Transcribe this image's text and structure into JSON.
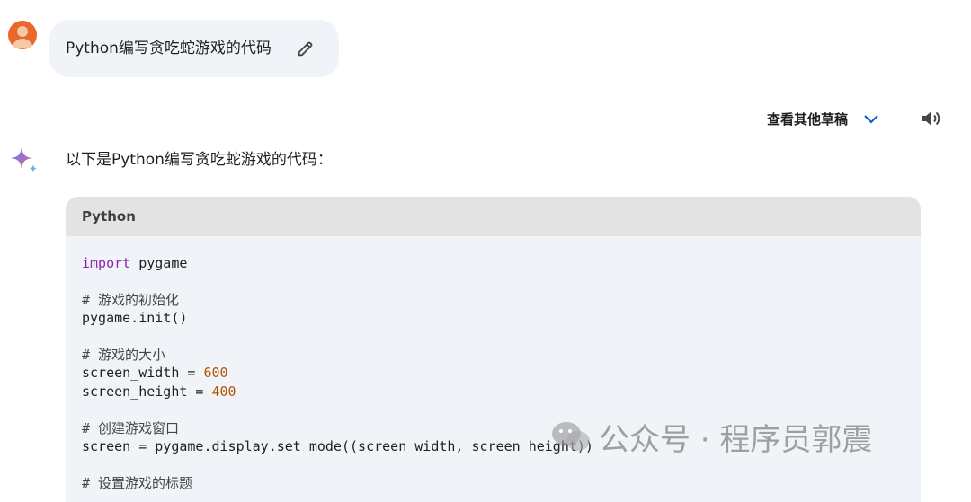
{
  "conversation": {
    "user_prompt": "Python编写贪吃蛇游戏的代码",
    "view_drafts_label": "查看其他草稿",
    "reply_intro": "以下是Python编写贪吃蛇游戏的代码："
  },
  "code_block": {
    "language": "Python",
    "lines": [
      {
        "parts": [
          {
            "t": "import",
            "c": "kw"
          },
          {
            "t": " pygame"
          }
        ]
      },
      {
        "parts": []
      },
      {
        "parts": [
          {
            "t": "# 游戏的初始化",
            "c": "comment"
          }
        ]
      },
      {
        "parts": [
          {
            "t": "pygame.init()"
          }
        ]
      },
      {
        "parts": []
      },
      {
        "parts": [
          {
            "t": "# 游戏的大小",
            "c": "comment"
          }
        ]
      },
      {
        "parts": [
          {
            "t": "screen_width = "
          },
          {
            "t": "600",
            "c": "num"
          }
        ]
      },
      {
        "parts": [
          {
            "t": "screen_height = "
          },
          {
            "t": "400",
            "c": "num"
          }
        ]
      },
      {
        "parts": []
      },
      {
        "parts": [
          {
            "t": "# 创建游戏窗口",
            "c": "comment"
          }
        ]
      },
      {
        "parts": [
          {
            "t": "screen = pygame.display.set_mode((screen_width, screen_height))"
          }
        ]
      },
      {
        "parts": []
      },
      {
        "parts": [
          {
            "t": "# 设置游戏的标题",
            "c": "comment"
          }
        ]
      }
    ]
  },
  "watermark": {
    "text": "公众号 · 程序员郭震"
  },
  "icons": {
    "avatar": "user-avatar",
    "edit": "pencil-icon",
    "chevron": "chevron-down-icon",
    "speaker": "speaker-icon",
    "assistant": "gemini-sparkle-icon",
    "watermark_logo": "wechat-icon"
  },
  "colors": {
    "keyword": "#8e24aa",
    "number": "#b55400",
    "accent_blue": "#0b57d0",
    "avatar": "#e9692c"
  }
}
